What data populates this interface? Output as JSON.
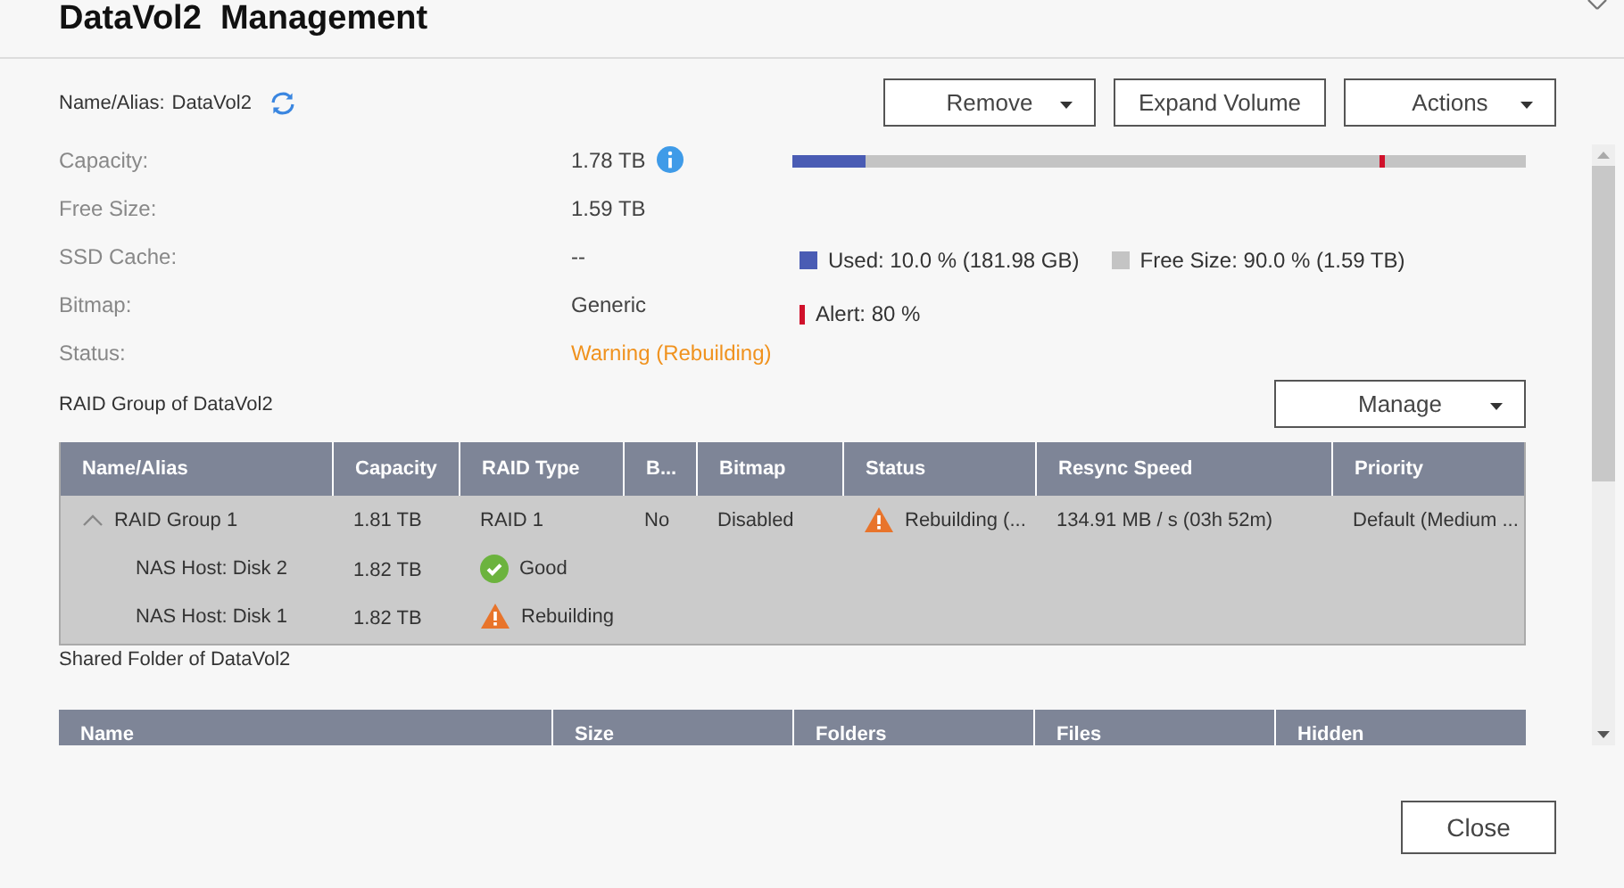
{
  "window": {
    "title": "DataVol2  Management"
  },
  "name_alias": {
    "label": "Name/Alias:",
    "value": "DataVol2"
  },
  "buttons": [
    {
      "label": "Remove",
      "dropdown": true
    },
    {
      "label": "Expand Volume",
      "dropdown": false
    },
    {
      "label": "Actions",
      "dropdown": true
    }
  ],
  "properties": [
    {
      "label": "Capacity:",
      "value": "1.78 TB",
      "info": true,
      "warning": false
    },
    {
      "label": "Free Size:",
      "value": "1.59 TB",
      "info": false,
      "warning": false
    },
    {
      "label": "SSD Cache:",
      "value": "--",
      "info": false,
      "warning": false
    },
    {
      "label": "Bitmap:",
      "value": "Generic",
      "info": false,
      "warning": false
    },
    {
      "label": "Status:",
      "value": "Warning (Rebuilding)",
      "info": false,
      "warning": true
    }
  ],
  "usage": {
    "used": {
      "label": "Used: 10.0 % (181.98 GB)",
      "level": 0.1,
      "color": "#4a5cb4"
    },
    "free": {
      "label": "Free Size: 90.0 % (1.59 TB)",
      "color": "#c4c4c4"
    },
    "alert": {
      "label": "Alert: 80 %",
      "level": 0.8,
      "color": "#d0112b"
    }
  },
  "raid_section": {
    "title": "RAID Group of DataVol2",
    "button": "Manage"
  },
  "raid_table": {
    "columns": [
      "Name/Alias",
      "Capacity",
      "RAID Type",
      "B...",
      "Bitmap",
      "Status",
      "Resync Speed",
      "Priority"
    ],
    "rows": [
      {
        "name": "RAID Group 1",
        "expanded": true,
        "capacity": "1.81 TB",
        "raid_type": "RAID 1",
        "b": "No",
        "bitmap": "Disabled",
        "status": {
          "kind": "warning",
          "text": "Rebuilding (..."
        },
        "resync_speed": "134.91 MB / s (03h 52m)",
        "priority": "Default (Medium ...",
        "children": [
          {
            "name": "NAS Host: Disk 2",
            "capacity": "1.82 TB",
            "status": {
              "kind": "good",
              "text": "Good"
            }
          },
          {
            "name": "NAS Host: Disk 1",
            "capacity": "1.82 TB",
            "status": {
              "kind": "warning",
              "text": "Rebuilding"
            }
          }
        ]
      }
    ]
  },
  "shared_section": {
    "title": "Shared Folder of DataVol2"
  },
  "shared_table": {
    "columns": [
      "Name",
      "Size",
      "Folders",
      "Files",
      "Hidden"
    ]
  },
  "footer": {
    "button": "Close"
  }
}
